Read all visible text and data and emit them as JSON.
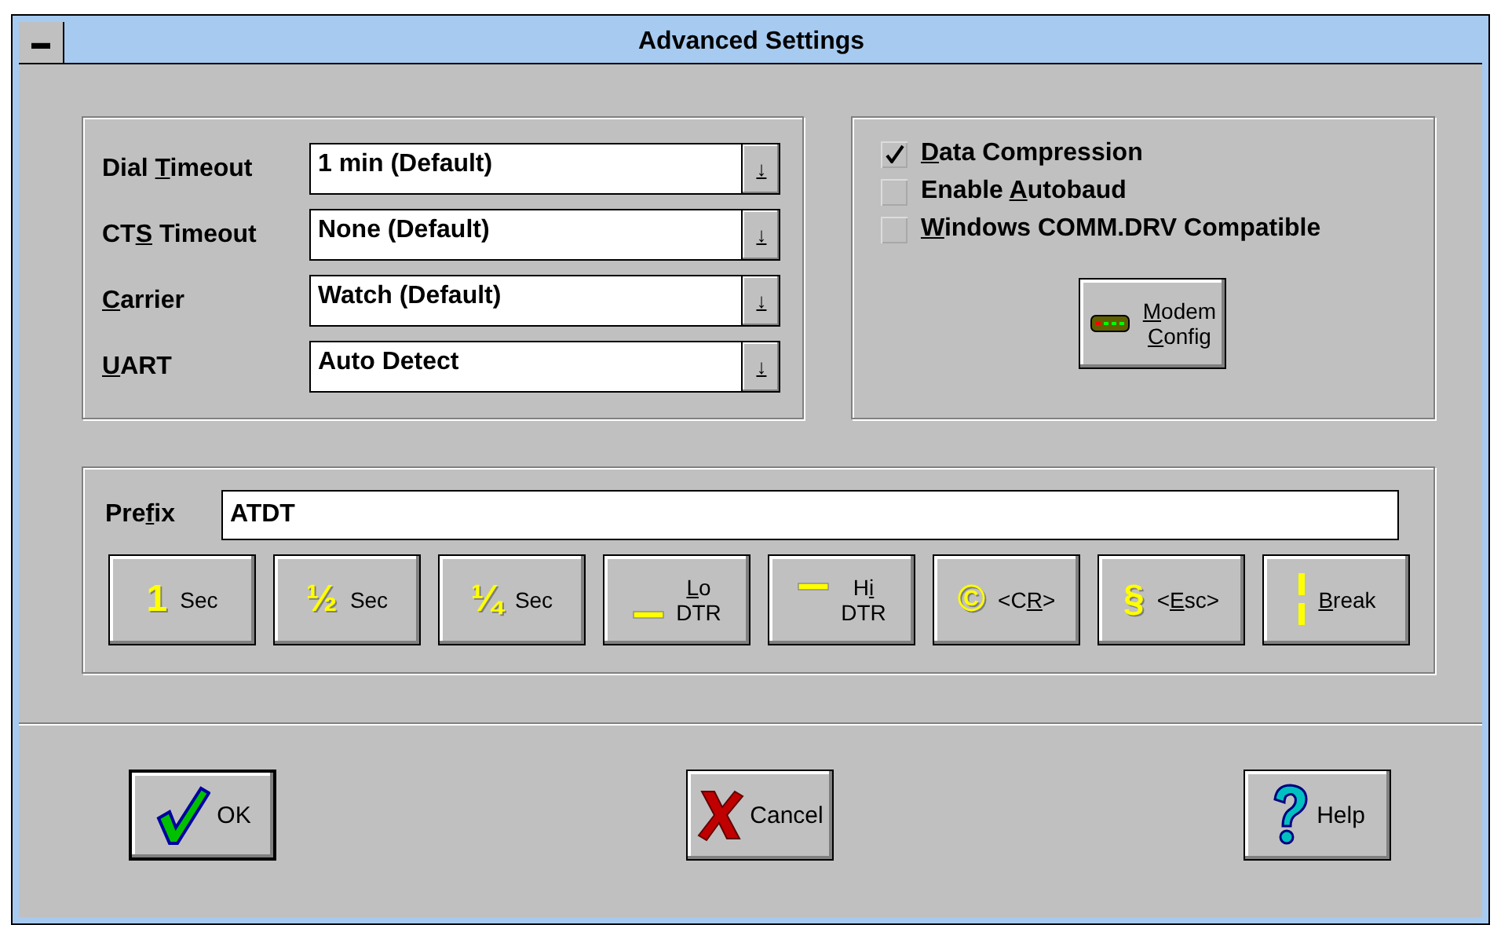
{
  "window": {
    "title": "Advanced Settings",
    "menu_glyph": "▬"
  },
  "dropdowns": [
    {
      "label": [
        {
          "text": "Dial "
        },
        {
          "text": "T",
          "u": true
        },
        {
          "text": "imeout"
        }
      ],
      "value": "1 min (Default)",
      "arrow": "↓"
    },
    {
      "label": [
        {
          "text": "CT"
        },
        {
          "text": "S",
          "u": true
        },
        {
          "text": " Timeout"
        }
      ],
      "value": "None (Default)",
      "arrow": "↓"
    },
    {
      "label": [
        {
          "text": "C",
          "u": true
        },
        {
          "text": "arrier"
        }
      ],
      "value": "Watch (Default)",
      "arrow": "↓"
    },
    {
      "label": [
        {
          "text": "U",
          "u": true
        },
        {
          "text": "ART"
        }
      ],
      "value": "Auto Detect",
      "arrow": "↓"
    }
  ],
  "checkboxes": [
    {
      "label": [
        {
          "text": "D",
          "u": true
        },
        {
          "text": "ata Compression"
        }
      ],
      "checked": true
    },
    {
      "label": [
        {
          "text": "Enable "
        },
        {
          "text": "A",
          "u": true
        },
        {
          "text": "utobaud"
        }
      ],
      "checked": false
    },
    {
      "label": [
        {
          "text": "W",
          "u": true
        },
        {
          "text": "indows COMM.DRV Compatible"
        }
      ],
      "checked": false
    }
  ],
  "modem_button": {
    "lines": [
      [
        {
          "text": "M",
          "u": true
        },
        {
          "text": "odem"
        }
      ],
      [
        {
          "text": "C",
          "u": true
        },
        {
          "text": "onfig"
        }
      ]
    ]
  },
  "prefix": {
    "label": [
      {
        "text": "Pre"
      },
      {
        "text": "f",
        "u": true
      },
      {
        "text": "ix"
      }
    ],
    "value": "ATDT"
  },
  "prefix_buttons": [
    {
      "kind": "glyph",
      "glyph": "1",
      "lines": [
        [
          {
            "text": "Sec"
          }
        ]
      ]
    },
    {
      "kind": "glyph",
      "glyph": "½",
      "lines": [
        [
          {
            "text": "Sec"
          }
        ]
      ]
    },
    {
      "kind": "glyph",
      "glyph": "¼",
      "lines": [
        [
          {
            "text": "Sec"
          }
        ]
      ]
    },
    {
      "kind": "dash_lo",
      "lines": [
        [
          {
            "text": "L",
            "u": true
          },
          {
            "text": "o"
          }
        ],
        [
          {
            "text": "DTR"
          }
        ]
      ]
    },
    {
      "kind": "dash_hi",
      "lines": [
        [
          {
            "text": "H"
          },
          {
            "text": "i",
            "u": true
          }
        ],
        [
          {
            "text": "DTR"
          }
        ]
      ]
    },
    {
      "kind": "glyph",
      "glyph": "©",
      "lines": [
        [
          {
            "text": "<C"
          },
          {
            "text": "R",
            "u": true
          },
          {
            "text": ">"
          }
        ]
      ]
    },
    {
      "kind": "glyph",
      "glyph": "§",
      "lines": [
        [
          {
            "text": "<"
          },
          {
            "text": "E",
            "u": true
          },
          {
            "text": "sc>"
          }
        ]
      ]
    },
    {
      "kind": "bar",
      "lines": [
        [
          {
            "text": "B",
            "u": true
          },
          {
            "text": "reak"
          }
        ]
      ]
    }
  ],
  "footer_buttons": [
    {
      "kind": "check",
      "label": "OK",
      "default": true
    },
    {
      "kind": "cross",
      "label": "Cancel",
      "default": false
    },
    {
      "kind": "question",
      "label": "Help",
      "default": false
    }
  ]
}
